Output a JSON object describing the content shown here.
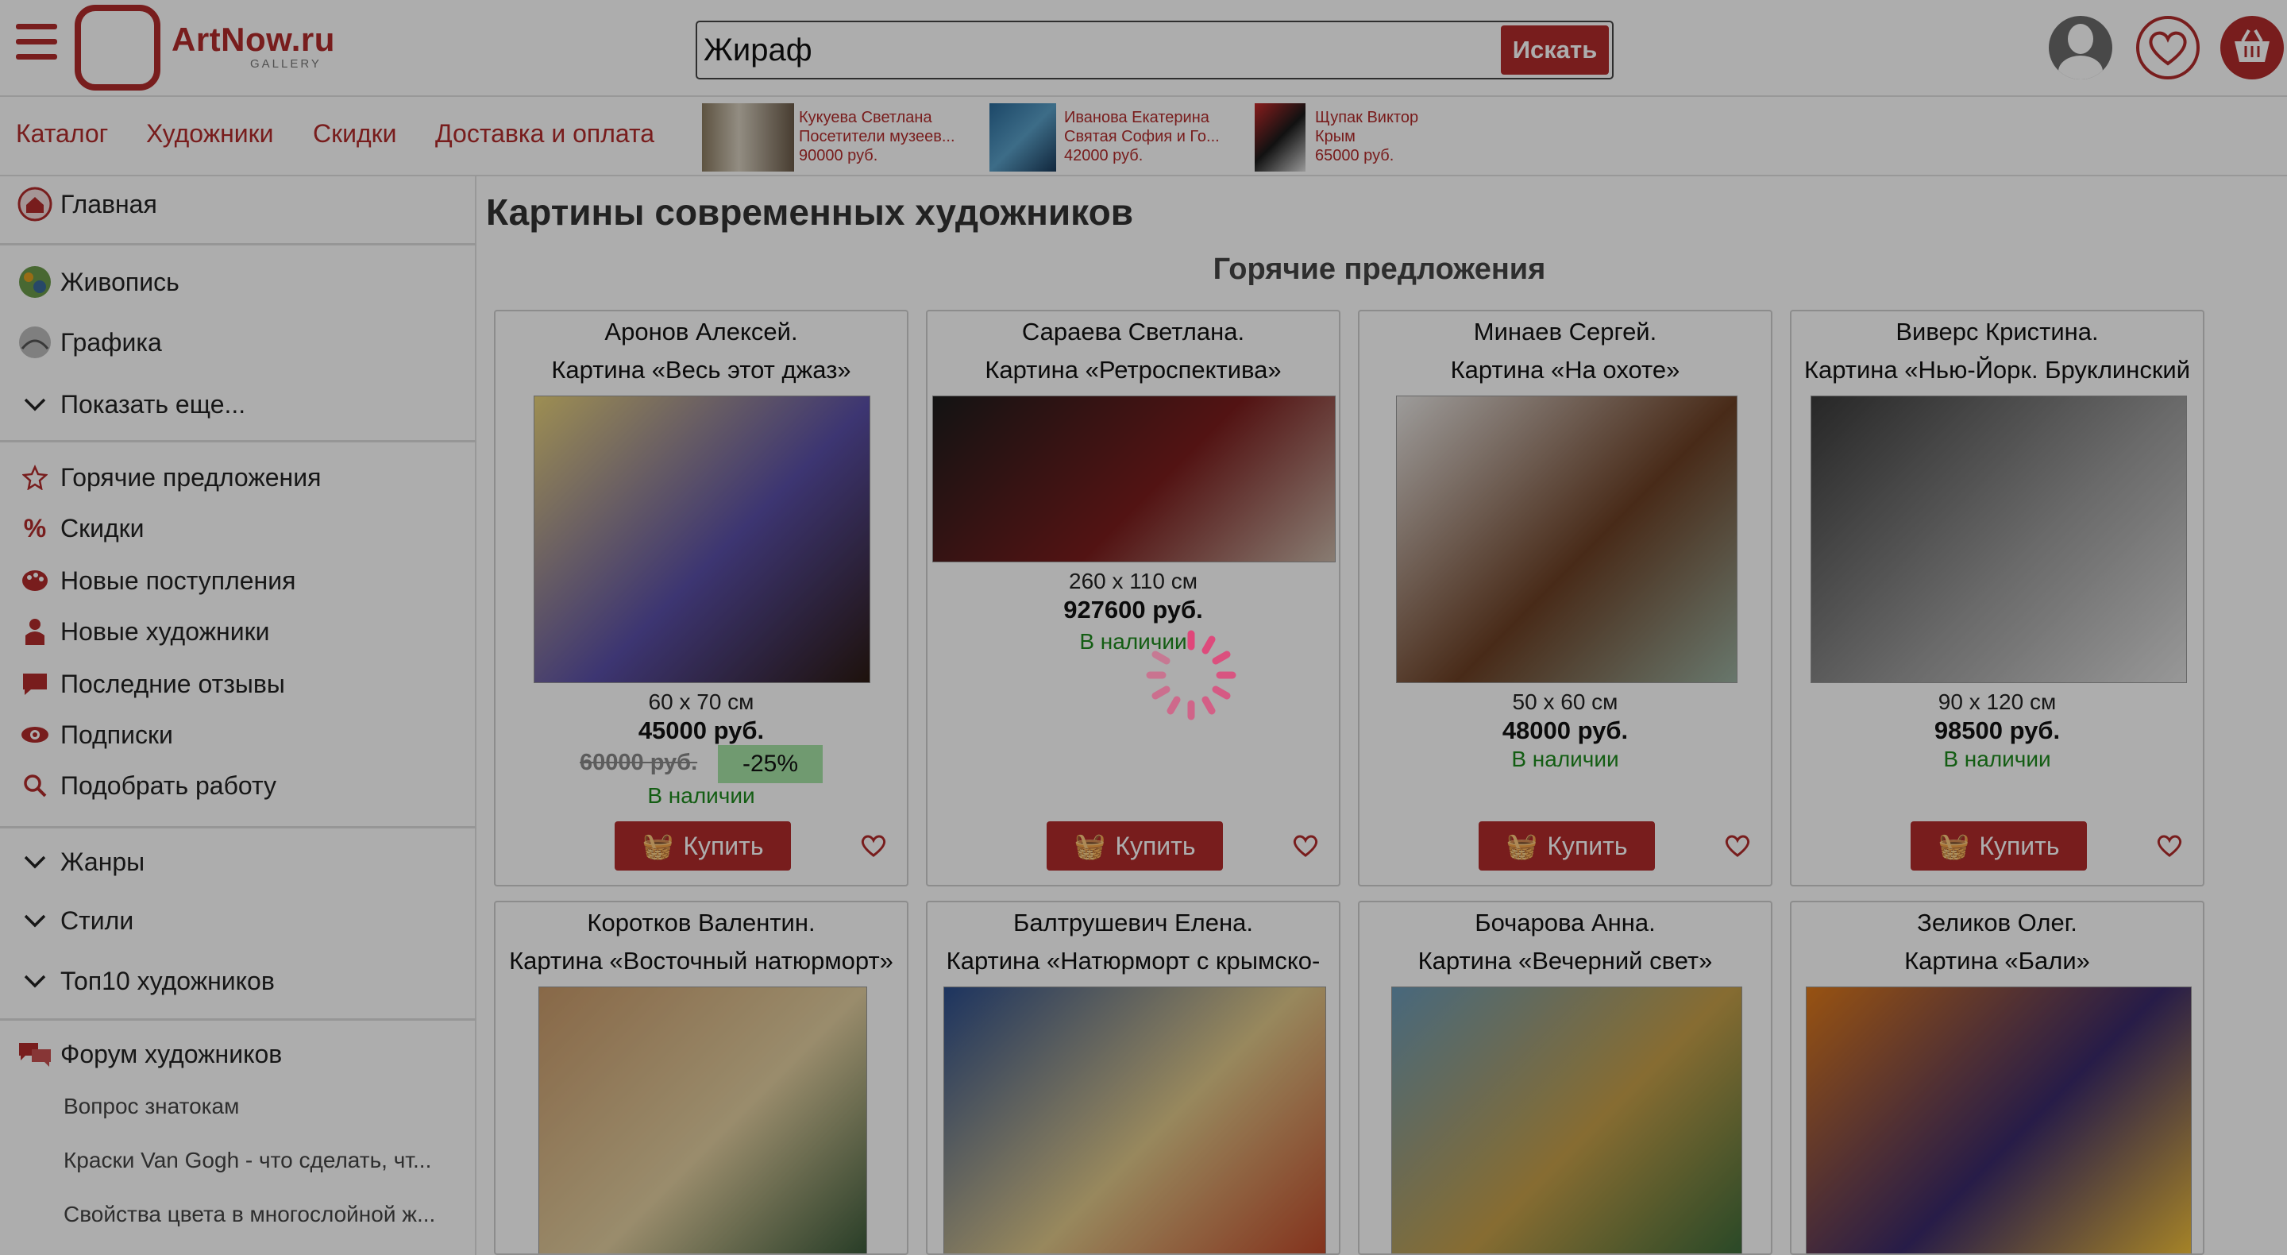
{
  "header": {
    "logo_text": "ArtNow.ru",
    "logo_sub": "GALLERY",
    "search_value": "Жираф",
    "search_button": "Искать",
    "icons": [
      "menu-icon",
      "user-icon",
      "heart-icon",
      "cart-icon"
    ]
  },
  "nav": {
    "links": [
      "Каталог",
      "Художники",
      "Скидки",
      "Доставка и оплата"
    ],
    "recent": [
      {
        "artist": "Кукуева Светлана",
        "title": "Посетители музеев...",
        "price": "90000 руб."
      },
      {
        "artist": "Иванова Екатерина",
        "title": "Святая София и Го...",
        "price": "42000 руб."
      },
      {
        "artist": "Щупак Виктор",
        "title": "Крым",
        "price": "65000 руб."
      }
    ]
  },
  "sidebar": {
    "home": "Главная",
    "painting": "Живопись",
    "graphics": "Графика",
    "show_more": "Показать еще...",
    "hot": "Горячие предложения",
    "discounts": "Скидки",
    "new_arrivals": "Новые поступления",
    "new_artists": "Новые художники",
    "reviews": "Последние отзывы",
    "subscriptions": "Подписки",
    "pick_work": "Подобрать работу",
    "genres": "Жанры",
    "styles": "Стили",
    "top10": "Топ10 художников",
    "forum": "Форум художников",
    "forum_topics": [
      "Вопрос знатокам",
      "Краски Van Gogh - что сделать, чт...",
      "Свойства цвета в многослойной ж..."
    ]
  },
  "main": {
    "page_title": "Картины современных художников",
    "section_title": "Горячие предложения",
    "buy_label": "Купить",
    "cards": [
      {
        "artist": "Аронов Алексей.",
        "title": "Картина «Весь этот джаз»",
        "size": "60 x 70 см",
        "price": "45000 руб.",
        "old_price": "60000 руб.",
        "discount": "-25%",
        "stock": "В наличии",
        "img_colors": [
          "#e8d27a",
          "#5a4fa8",
          "#2c1a12"
        ]
      },
      {
        "artist": "Сараева Светлана.",
        "title": "Картина «Ретроспектива»",
        "size": "260 x 110 см",
        "price": "927600 руб.",
        "stock": "В наличии",
        "img_colors": [
          "#1c1c1c",
          "#7a1c1c",
          "#c9b7a8"
        ]
      },
      {
        "artist": "Минаев Сергей.",
        "title": "Картина «На охоте»",
        "size": "50 x 60 см",
        "price": "48000 руб.",
        "stock": "В наличии",
        "img_colors": [
          "#e8e6e4",
          "#6b3f24",
          "#9ab0a0"
        ]
      },
      {
        "artist": "Виверс Кристина.",
        "title": "Картина «Нью-Йорк. Бруклинский",
        "size": "90 x 120 см",
        "price": "98500 руб.",
        "stock": "В наличии",
        "img_colors": [
          "#3a3a3a",
          "#9a9a9a",
          "#e0e0e0"
        ]
      },
      {
        "artist": "Коротков Валентин.",
        "title": "Картина «Восточный натюрморт»",
        "img_colors": [
          "#c99a6a",
          "#e3cfa0",
          "#3b5a3a"
        ]
      },
      {
        "artist": "Балтрушевич Елена.",
        "title": "Картина «Натюрморт с крымско-",
        "img_colors": [
          "#2b4d8c",
          "#e0c98a",
          "#c24a2a"
        ]
      },
      {
        "artist": "Бочарова Анна.",
        "title": "Картина «Вечерний свет»",
        "img_colors": [
          "#6a9ab8",
          "#c7a04a",
          "#3d6b3a"
        ]
      },
      {
        "artist": "Зеликов Олег.",
        "title": "Картина «Бали»",
        "img_colors": [
          "#e07a1a",
          "#3a2a6a",
          "#f4c23a"
        ]
      }
    ]
  }
}
